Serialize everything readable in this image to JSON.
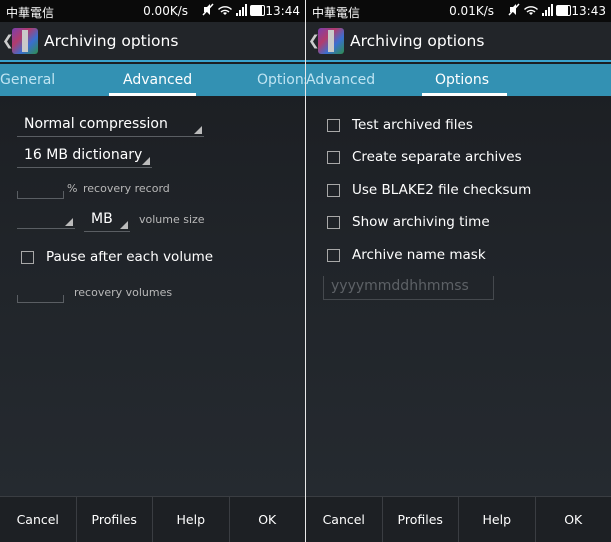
{
  "left": {
    "status": {
      "carrier": "中華電信",
      "speed": "0.00K/s",
      "battery": "",
      "clock": "13:44"
    },
    "title": "Archiving options",
    "tabs": [
      "General",
      "Advanced",
      "Options"
    ],
    "active_tab": "Advanced",
    "compression": "Normal compression",
    "dictionary": "16 MB dictionary",
    "recovery_percent_symbol": "%",
    "recovery_record_label": "recovery record",
    "volume_unit": "MB",
    "volume_size_label": "volume size",
    "pause_label": "Pause after each volume",
    "recovery_volumes_label": "recovery volumes",
    "buttons": {
      "cancel": "Cancel",
      "profiles": "Profiles",
      "help": "Help",
      "ok": "OK"
    }
  },
  "right": {
    "status": {
      "carrier": "中華電信",
      "speed": "0.01K/s",
      "clock": "13:43"
    },
    "title": "Archiving options",
    "tabs": [
      "Advanced",
      "Options"
    ],
    "active_tab": "Options",
    "options": [
      "Test archived files",
      "Create separate archives",
      "Use BLAKE2 file checksum",
      "Show archiving time",
      "Archive name mask"
    ],
    "mask_placeholder": "yyyymmddhhmmss",
    "buttons": {
      "cancel": "Cancel",
      "profiles": "Profiles",
      "help": "Help",
      "ok": "OK"
    }
  },
  "colors": {
    "accent": "#3aa4cf",
    "tabbar": "#3391b3",
    "background": "#1e2125"
  },
  "icons": [
    "back-chevron-icon",
    "winrar-app-icon",
    "mute-icon",
    "wifi-icon",
    "signal-icon",
    "battery-icon"
  ]
}
